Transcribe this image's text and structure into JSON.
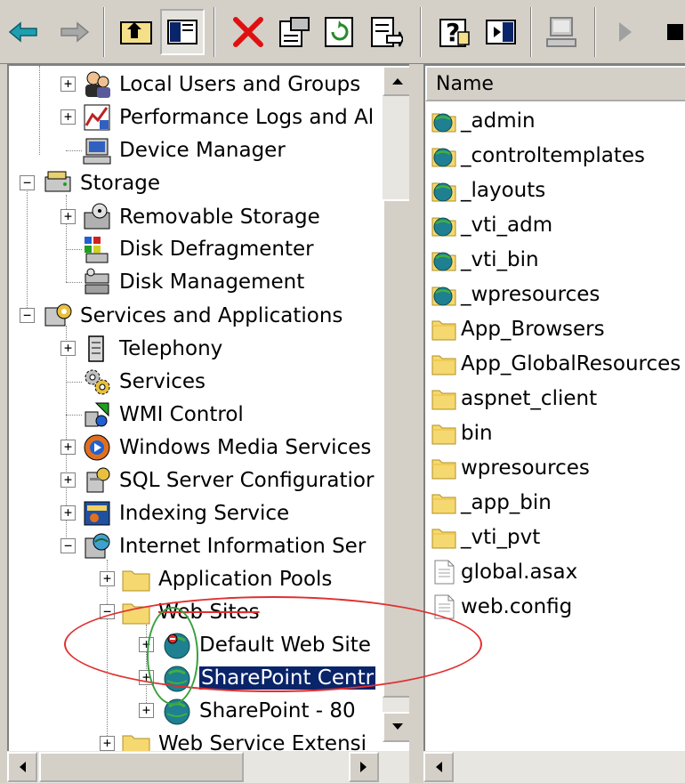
{
  "toolbar": {
    "icons": [
      "back-arrow-icon",
      "forward-arrow-icon",
      "up-folder-icon",
      "show-hide-tree-icon",
      "delete-icon",
      "properties-icon",
      "refresh-icon",
      "export-list-icon",
      "help-icon",
      "action-pane-icon",
      "computer-icon",
      "play-icon",
      "stop-icon"
    ]
  },
  "tree": {
    "items": [
      {
        "label": "Local Users and Groups"
      },
      {
        "label": "Performance Logs and Al"
      },
      {
        "label": "Device Manager"
      },
      {
        "label": "Storage"
      },
      {
        "label": "Removable Storage"
      },
      {
        "label": "Disk Defragmenter"
      },
      {
        "label": "Disk Management"
      },
      {
        "label": "Services and Applications"
      },
      {
        "label": "Telephony"
      },
      {
        "label": "Services"
      },
      {
        "label": "WMI Control"
      },
      {
        "label": "Windows Media Services"
      },
      {
        "label": "SQL Server Configuratior"
      },
      {
        "label": "Indexing Service"
      },
      {
        "label": "Internet Information Ser"
      },
      {
        "label": "Application Pools"
      },
      {
        "label": "Web Sites"
      },
      {
        "label": "Default Web Site"
      },
      {
        "label": "SharePoint Centr"
      },
      {
        "label": "SharePoint - 80"
      },
      {
        "label": "Web Service Extensi"
      }
    ]
  },
  "list": {
    "column_header": "Name",
    "items": [
      {
        "label": "_admin",
        "type": "web-folder"
      },
      {
        "label": "_controltemplates",
        "type": "web-folder"
      },
      {
        "label": "_layouts",
        "type": "web-folder"
      },
      {
        "label": "_vti_adm",
        "type": "web-folder"
      },
      {
        "label": "_vti_bin",
        "type": "web-folder"
      },
      {
        "label": "_wpresources",
        "type": "web-folder"
      },
      {
        "label": "App_Browsers",
        "type": "folder"
      },
      {
        "label": "App_GlobalResources",
        "type": "folder"
      },
      {
        "label": "aspnet_client",
        "type": "folder"
      },
      {
        "label": "bin",
        "type": "folder"
      },
      {
        "label": "wpresources",
        "type": "folder"
      },
      {
        "label": "_app_bin",
        "type": "folder"
      },
      {
        "label": "_vti_pvt",
        "type": "folder"
      },
      {
        "label": "global.asax",
        "type": "file"
      },
      {
        "label": "web.config",
        "type": "file"
      }
    ]
  },
  "colors": {
    "selection": "#0a246a",
    "annotation_red": "#e03030",
    "annotation_green": "#3aa040",
    "window_gray": "#d4d0c8"
  }
}
